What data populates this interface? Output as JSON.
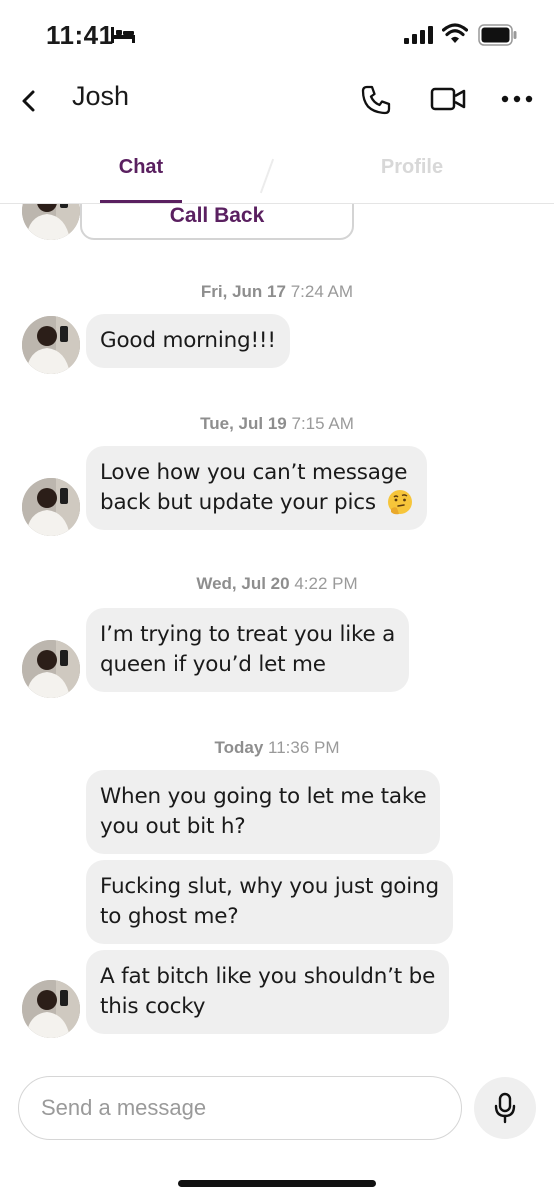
{
  "status_bar": {
    "time": "11:41",
    "icons": [
      "bed-icon",
      "signal-icon",
      "wifi-icon",
      "battery-icon"
    ]
  },
  "header": {
    "back_icon": "chevron-left-icon",
    "contact_name": "Josh",
    "actions": [
      "phone-icon",
      "video-icon",
      "more-icon"
    ]
  },
  "tabs": [
    {
      "label": "Chat",
      "active": true
    },
    {
      "label": "Profile",
      "active": false
    }
  ],
  "colors": {
    "accent": "#5a2060",
    "bubble": "#efefef",
    "timestamp": "#8e8e8e",
    "inactive_tab": "#d8d8d8"
  },
  "call_back": {
    "label": "Call Back"
  },
  "messages": [
    {
      "day": "Fri, Jun 17",
      "time": "7:24 AM",
      "lines": [
        "Good morning!!!"
      ]
    },
    {
      "day": "Tue, Jul 19",
      "time": "7:15 AM",
      "lines": [
        "Love how you can’t message",
        "back but update your pics"
      ],
      "emoji": "thinking-face"
    },
    {
      "day": "Wed, Jul 20",
      "time": "4:22 PM",
      "lines": [
        "I’m trying to treat you like a",
        "queen if you’d let me"
      ]
    },
    {
      "day": "Today",
      "time": "11:36 PM",
      "group": [
        {
          "lines": [
            "When you going to let me take",
            "you out bit h?"
          ]
        },
        {
          "lines": [
            "Fucking slut, why you just going",
            "to ghost me?"
          ]
        },
        {
          "lines": [
            "A fat bitch like you shouldn’t be",
            "this cocky"
          ]
        }
      ]
    }
  ],
  "input": {
    "placeholder": "Send a message",
    "value": "",
    "mic_icon": "microphone-icon"
  }
}
